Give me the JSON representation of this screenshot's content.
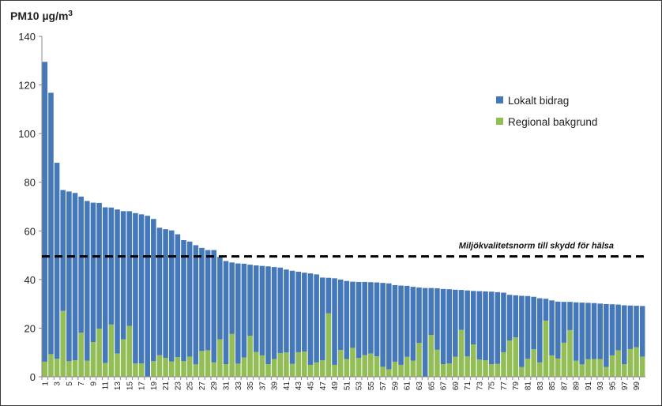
{
  "chart_data": {
    "type": "bar",
    "stacked": true,
    "ylabel_prefix": "PM10 µg/m",
    "ylabel_sup": "3",
    "ylim": [
      0,
      140
    ],
    "yticks": [
      0,
      20,
      40,
      60,
      80,
      100,
      120,
      140
    ],
    "grid": false,
    "legend_position": "top-right",
    "categories": [
      1,
      2,
      3,
      4,
      5,
      6,
      7,
      8,
      9,
      10,
      11,
      12,
      13,
      14,
      15,
      16,
      17,
      18,
      19,
      20,
      21,
      22,
      23,
      24,
      25,
      26,
      27,
      28,
      29,
      30,
      31,
      32,
      33,
      34,
      35,
      36,
      37,
      38,
      39,
      40,
      41,
      42,
      43,
      44,
      45,
      46,
      47,
      48,
      49,
      50,
      51,
      52,
      53,
      54,
      55,
      56,
      57,
      58,
      59,
      60,
      61,
      62,
      63,
      64,
      65,
      66,
      67,
      68,
      69,
      70,
      71,
      72,
      73,
      74,
      75,
      76,
      77,
      78,
      79,
      80,
      81,
      82,
      83,
      84,
      85,
      86,
      87,
      88,
      89,
      90,
      91,
      92,
      93,
      94,
      95,
      96,
      97,
      98,
      99,
      100
    ],
    "x_tick_labels": [
      1,
      3,
      5,
      7,
      9,
      11,
      13,
      15,
      17,
      19,
      21,
      23,
      25,
      27,
      29,
      31,
      33,
      35,
      37,
      39,
      41,
      43,
      45,
      47,
      49,
      51,
      53,
      55,
      57,
      59,
      61,
      63,
      65,
      67,
      69,
      71,
      73,
      75,
      77,
      79,
      81,
      83,
      85,
      87,
      89,
      91,
      93,
      95,
      97,
      99
    ],
    "totals": [
      129.5,
      116.8,
      88,
      76.8,
      76.2,
      75.6,
      74.1,
      72.3,
      71.6,
      71.5,
      69.7,
      69.6,
      68.8,
      68.1,
      68.1,
      67.3,
      66.8,
      66.2,
      64.9,
      61.3,
      60.7,
      60.2,
      58.6,
      56.2,
      55.6,
      54.1,
      53,
      52.1,
      52.1,
      49.3,
      47.6,
      47,
      46.6,
      46.5,
      46.1,
      45.8,
      45.6,
      45.4,
      45.1,
      44.9,
      44.1,
      43.6,
      43.2,
      42.8,
      42.5,
      42.1,
      40.8,
      40.7,
      40.5,
      40,
      39.4,
      39.1,
      39,
      39,
      38.9,
      38.8,
      38.6,
      38.4,
      37.7,
      37.5,
      37.4,
      37,
      36.7,
      36.5,
      36.5,
      36.4,
      36.1,
      36,
      35.8,
      35.7,
      35.5,
      35.3,
      35.2,
      35.1,
      35,
      34.8,
      34.6,
      33.7,
      33.5,
      33.3,
      33.2,
      32.9,
      32.3,
      32.1,
      31.4,
      30.9,
      30.8,
      30.8,
      30.6,
      30.5,
      30.4,
      30.3,
      30.1,
      29.9,
      29.8,
      29.7,
      29.4,
      29.3,
      29.2,
      29.1
    ],
    "series": [
      {
        "name": "Regional bakgrund",
        "color": "#92be55",
        "values": [
          6.2,
          9.3,
          7.4,
          27.1,
          6.4,
          6.8,
          18.1,
          6.6,
          14.3,
          19.8,
          5.7,
          21.5,
          9.6,
          15.4,
          20.9,
          5.5,
          5.5,
          0,
          6.4,
          8.9,
          7.8,
          6.3,
          8.1,
          6.4,
          8.3,
          5.1,
          10.6,
          10.9,
          5.9,
          15.4,
          5.2,
          17.6,
          5.4,
          7.9,
          16.9,
          10.2,
          8.8,
          5.2,
          7.3,
          9.7,
          10,
          5.3,
          10.1,
          10.4,
          4.9,
          5.9,
          6.8,
          26.1,
          4.9,
          11,
          7.3,
          11.9,
          7.7,
          8.9,
          9.6,
          8.4,
          4.1,
          3.1,
          6.2,
          4.9,
          8.2,
          6.6,
          13.9,
          0,
          17.2,
          11.1,
          5.2,
          5.5,
          8.2,
          19.3,
          8.4,
          13.3,
          7.1,
          6.8,
          5.2,
          5.3,
          10.1,
          14.9,
          16.2,
          4,
          7.4,
          11.3,
          5.9,
          23.1,
          8.8,
          7.5,
          14,
          19.2,
          6.6,
          5.1,
          7.2,
          7.3,
          7.3,
          4,
          8.8,
          10.9,
          5.2,
          11.4,
          12.1,
          8.3
        ]
      },
      {
        "name": "Lokalt bidrag",
        "color": "#4478b8",
        "values": [
          123.3,
          107.5,
          80.6,
          49.7,
          69.8,
          68.8,
          56,
          65.7,
          57.3,
          51.7,
          64,
          48.1,
          59.2,
          52.7,
          47.2,
          61.8,
          61.3,
          66.2,
          58.5,
          52.4,
          52.9,
          53.9,
          50.5,
          49.8,
          47.3,
          49,
          42.4,
          41.2,
          46.2,
          33.9,
          42.4,
          29.4,
          41.2,
          38.6,
          29.2,
          35.6,
          36.8,
          40.2,
          37.8,
          35.2,
          34.1,
          38.3,
          33.1,
          32.4,
          37.6,
          36.2,
          34,
          14.6,
          35.6,
          29,
          32.1,
          27.2,
          31.3,
          30.1,
          29.3,
          30.4,
          34.5,
          35.3,
          31.5,
          32.6,
          29.2,
          30.4,
          22.8,
          36.5,
          19.3,
          25.3,
          30.9,
          30.5,
          27.6,
          16.4,
          27.1,
          22,
          28.1,
          28.3,
          29.8,
          29.5,
          24.5,
          18.8,
          17.3,
          29.3,
          25.8,
          21.6,
          26.4,
          9,
          22.6,
          23.4,
          16.8,
          11.6,
          24,
          25.4,
          23.2,
          23,
          22.8,
          25.9,
          21,
          18.8,
          24.2,
          17.9,
          17.1,
          20.8
        ]
      }
    ],
    "reference_line": {
      "value": 49.5,
      "label": "Miljökvalitetsnorm till skydd för hälsa",
      "style": "dashed",
      "color": "#000000"
    }
  }
}
